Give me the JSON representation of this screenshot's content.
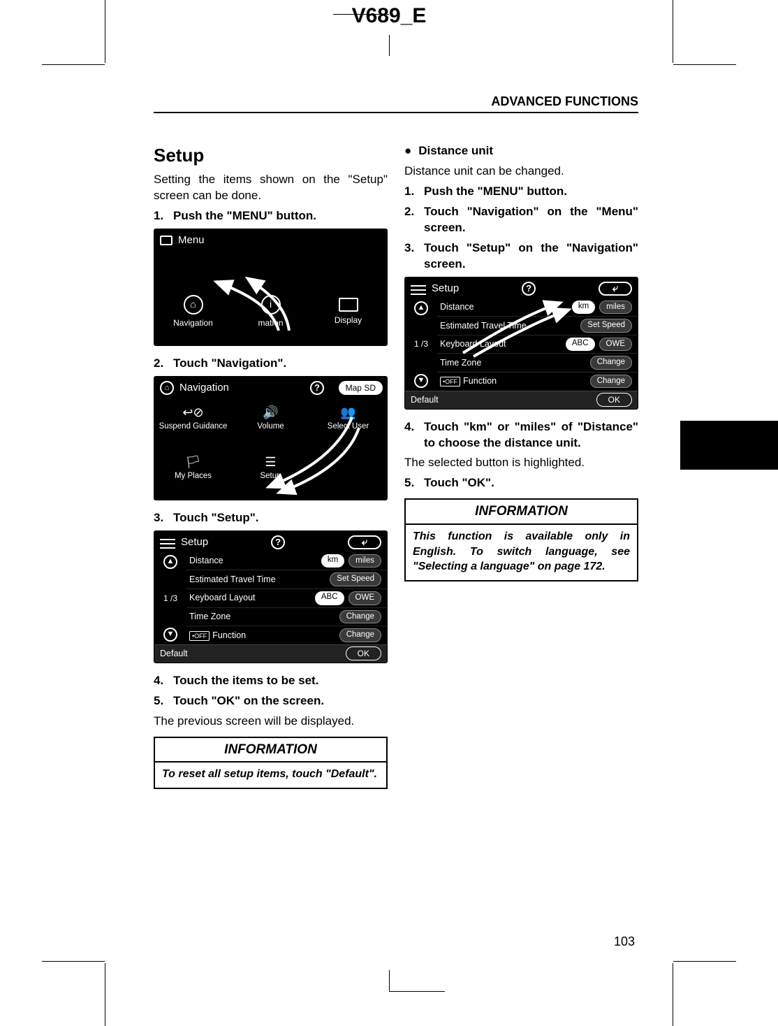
{
  "doc_header": "V689_E",
  "section_header": "ADVANCED FUNCTIONS",
  "page_number": "103",
  "left": {
    "title": "Setup",
    "intro": "Setting the items shown on the \"Setup\" screen can be done.",
    "steps": {
      "s1": "Push the \"MENU\" button.",
      "s2": "Touch \"Navigation\".",
      "s3": "Touch \"Setup\".",
      "s4": "Touch the items to be set.",
      "s5": "Touch \"OK\" on the screen."
    },
    "note": "The previous screen will be displayed.",
    "info_title": "INFORMATION",
    "info_body": "To reset all setup items, touch \"Default\"."
  },
  "right": {
    "bullet": "Distance unit",
    "intro": "Distance unit can be changed.",
    "steps": {
      "s1": "Push the \"MENU\" button.",
      "s2": "Touch \"Navigation\" on the \"Menu\" screen.",
      "s3": "Touch \"Setup\" on the \"Navigation\" screen.",
      "s4": "Touch \"km\" or \"miles\" of \"Distance\" to choose the distance unit.",
      "s5": "Touch \"OK\"."
    },
    "note": "The selected button is highlighted.",
    "info_title": "INFORMATION",
    "info_body": "This function is available only in English. To switch language, see \"Selecting a language\" on page 172."
  },
  "screens": {
    "menu": {
      "title": "Menu",
      "items": {
        "nav": "Navigation",
        "info": "mation",
        "disp": "Display"
      },
      "info_glyph": "i"
    },
    "nav": {
      "title": "Navigation",
      "mapsd": "Map SD",
      "help": "?",
      "items": {
        "suspend": "Suspend Guidance",
        "volume": "Volume",
        "select": "Select User",
        "places": "My Places",
        "setup": "Setup"
      }
    },
    "setup": {
      "title": "Setup",
      "help": "?",
      "back": "⤶",
      "page": "1 /3",
      "rows": {
        "distance": "Distance",
        "ett": "Estimated Travel Time",
        "kbd": "Keyboard Layout",
        "tz": "Time Zone",
        "func_off": "Off",
        "func": "Function"
      },
      "pills": {
        "km": "km",
        "miles": "miles",
        "setspeed": "Set Speed",
        "abc": "ABC",
        "owe": "OWE",
        "change": "Change"
      },
      "default": "Default",
      "ok": "OK",
      "up": "▲",
      "down": "▼",
      "off_tag": "•OFF"
    }
  }
}
